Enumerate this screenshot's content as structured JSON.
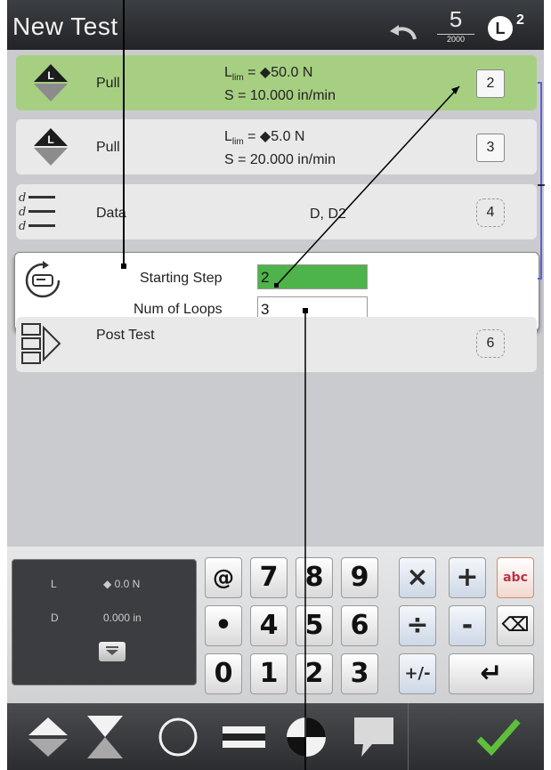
{
  "header": {
    "title": "New Test",
    "step_count": "5",
    "step_count_sub": "2000",
    "load_badge": "L",
    "load_badge_sup": "2"
  },
  "steps": [
    {
      "name": "Pull",
      "param_line1_prefix": "L",
      "param_line1_sub": "lim",
      "param_line1_rest": " = ◆50.0 N",
      "param_line2": "S = 10.000 in/min",
      "number": "2"
    },
    {
      "name": "Pull",
      "param_line1_prefix": "L",
      "param_line1_sub": "lim",
      "param_line1_rest": " = ◆5.0 N",
      "param_line2": "S = 20.000 in/min",
      "number": "3"
    },
    {
      "name": "Data",
      "param": "D, D2",
      "number": "4"
    },
    {
      "name": "Post Test",
      "number": "6"
    }
  ],
  "loop": {
    "starting_step_label": "Starting Step",
    "starting_step_value": "2",
    "num_loops_label": "Num of Loops",
    "num_loops_value": "3"
  },
  "readout": {
    "load_label": "L",
    "load_value": "◆ 0.0 N",
    "disp_label": "D",
    "disp_value": "0.000 in"
  },
  "keypad": {
    "row1": [
      "@",
      "7",
      "8",
      "9",
      "×",
      "+",
      "abc"
    ],
    "row2": [
      "•",
      "4",
      "5",
      "6",
      "÷",
      "-",
      "⌫"
    ],
    "row3": [
      "0",
      "1",
      "2",
      "3",
      "+/-",
      "↵"
    ]
  },
  "colors": {
    "selected_step": "#a7cf82",
    "active_field": "#4db34a",
    "loop_bracket": "#5a5fd6",
    "confirm": "#5fbf3a"
  }
}
